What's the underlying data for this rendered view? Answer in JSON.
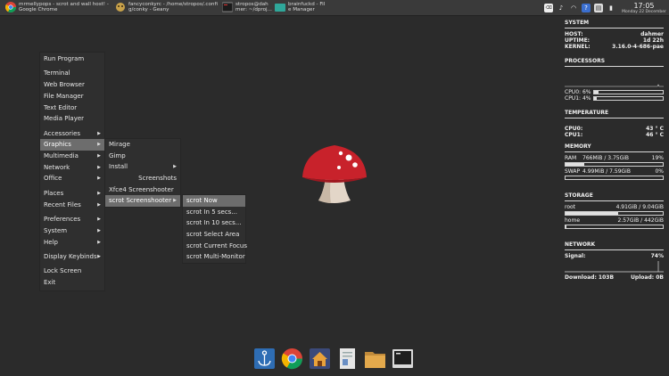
{
  "taskbar": {
    "tasks": [
      {
        "title": "mrmellypops - scrot and wall host! - Google Chrome",
        "line1": "mrmellypops - scrot and wall host! -",
        "line2": "Google Chrome",
        "icon": "chrome-icon"
      },
      {
        "title": "fancyconkyrc - /home/stropos/.config/conky - Geany",
        "line1": "fancyconkyrc - /home/stropos/.confi",
        "line2": "g/conky - Geany",
        "icon": "geany-icon"
      },
      {
        "title": "stropos@dahmer: ~/dproj",
        "line1": "stropos@dah",
        "line2": "mer: ~/dproj...",
        "icon": "terminal-icon"
      },
      {
        "title": "brainfuckd - File Manager",
        "line1": "brainfuckd - Fil",
        "line2": "e Manager",
        "icon": "folder-icon"
      }
    ],
    "clock": {
      "time": "17:05",
      "date": "Monday 22 December"
    }
  },
  "main_menu": {
    "items": [
      {
        "label": "Run Program",
        "submenu": false
      },
      {
        "label": "Terminal",
        "submenu": false,
        "gap": true
      },
      {
        "label": "Web Browser",
        "submenu": false
      },
      {
        "label": "File Manager",
        "submenu": false
      },
      {
        "label": "Text Editor",
        "submenu": false
      },
      {
        "label": "Media Player",
        "submenu": false
      },
      {
        "label": "Accessories",
        "submenu": true,
        "gap": true
      },
      {
        "label": "Graphics",
        "submenu": true,
        "highlighted": true
      },
      {
        "label": "Multimedia",
        "submenu": true
      },
      {
        "label": "Network",
        "submenu": true
      },
      {
        "label": "Office",
        "submenu": true
      },
      {
        "label": "Places",
        "submenu": true,
        "gap": true
      },
      {
        "label": "Recent Files",
        "submenu": true
      },
      {
        "label": "Preferences",
        "submenu": true,
        "gap": true
      },
      {
        "label": "System",
        "submenu": true
      },
      {
        "label": "Help",
        "submenu": true
      },
      {
        "label": "Display Keybinds",
        "submenu": true,
        "gap": true
      },
      {
        "label": "Lock Screen",
        "submenu": false,
        "gap": true
      },
      {
        "label": "Exit",
        "submenu": false
      }
    ]
  },
  "graphics_menu": {
    "items": [
      {
        "label": "Mirage",
        "submenu": false
      },
      {
        "label": "Gimp",
        "submenu": false
      },
      {
        "label": "Install",
        "submenu": true
      },
      {
        "label": "Screenshots",
        "submenu": false,
        "align": "right"
      },
      {
        "label": "Xfce4 Screenshooter",
        "submenu": false
      },
      {
        "label": "scrot Screenshooter",
        "submenu": true,
        "highlighted": true
      }
    ]
  },
  "scrot_menu": {
    "items": [
      {
        "label": "scrot Now",
        "highlighted": true
      },
      {
        "label": "scrot In 5 secs..."
      },
      {
        "label": "scrot In 10 secs..."
      },
      {
        "label": "scrot Select Area"
      },
      {
        "label": "scrot Current Focus"
      },
      {
        "label": "scrot Multi-Monitor"
      }
    ]
  },
  "dock": {
    "items": [
      "anchor-icon",
      "chrome-icon",
      "home-folder-icon",
      "document-icon",
      "folder-icon",
      "terminal-icon"
    ]
  },
  "conky": {
    "system": {
      "heading": "SYSTEM",
      "rows": [
        {
          "key": "HOST:",
          "value": "dahmer"
        },
        {
          "key": "UPTIME:",
          "value": "1d 22h"
        },
        {
          "key": "KERNEL:",
          "value": "3.16.0-4-686-pae"
        }
      ]
    },
    "processors": {
      "heading": "PROCESSORS",
      "cpus": [
        {
          "label": "CPU0: 6%",
          "percent": 6
        },
        {
          "label": "CPU1: 4%",
          "percent": 4
        }
      ]
    },
    "temperature": {
      "heading": "TEMPERATURE",
      "rows": [
        {
          "key": "CPU0:",
          "value": "43 ° C"
        },
        {
          "key": "CPU1:",
          "value": "46 ° C"
        }
      ]
    },
    "memory": {
      "heading": "MEMORY",
      "rows": [
        {
          "label": "RAM",
          "value": "766MiB / 3.75GiB",
          "pct": "19%",
          "percent": 19
        },
        {
          "label": "SWAP",
          "value": "4.99MiB / 7.59GiB",
          "pct": "0%",
          "percent": 0
        }
      ]
    },
    "storage": {
      "heading": "STORAGE",
      "rows": [
        {
          "label": "root",
          "value": "4.91GiB / 9.04GiB",
          "percent": 54
        },
        {
          "label": "home",
          "value": "2.57GiB / 442GiB",
          "percent": 1
        }
      ]
    },
    "network": {
      "heading": "NETWORK",
      "signal_label": "Signal:",
      "signal_value": "74%",
      "download": "Download: 103B",
      "upload": "Upload: 0B"
    }
  },
  "colors": {
    "desktop": "#2b2b2b",
    "menu_bg": "#2f2f2f",
    "menu_highlight": "#6d6d6d",
    "mushroom_cap": "#c8222b",
    "mushroom_stem": "#e3d6c8"
  }
}
